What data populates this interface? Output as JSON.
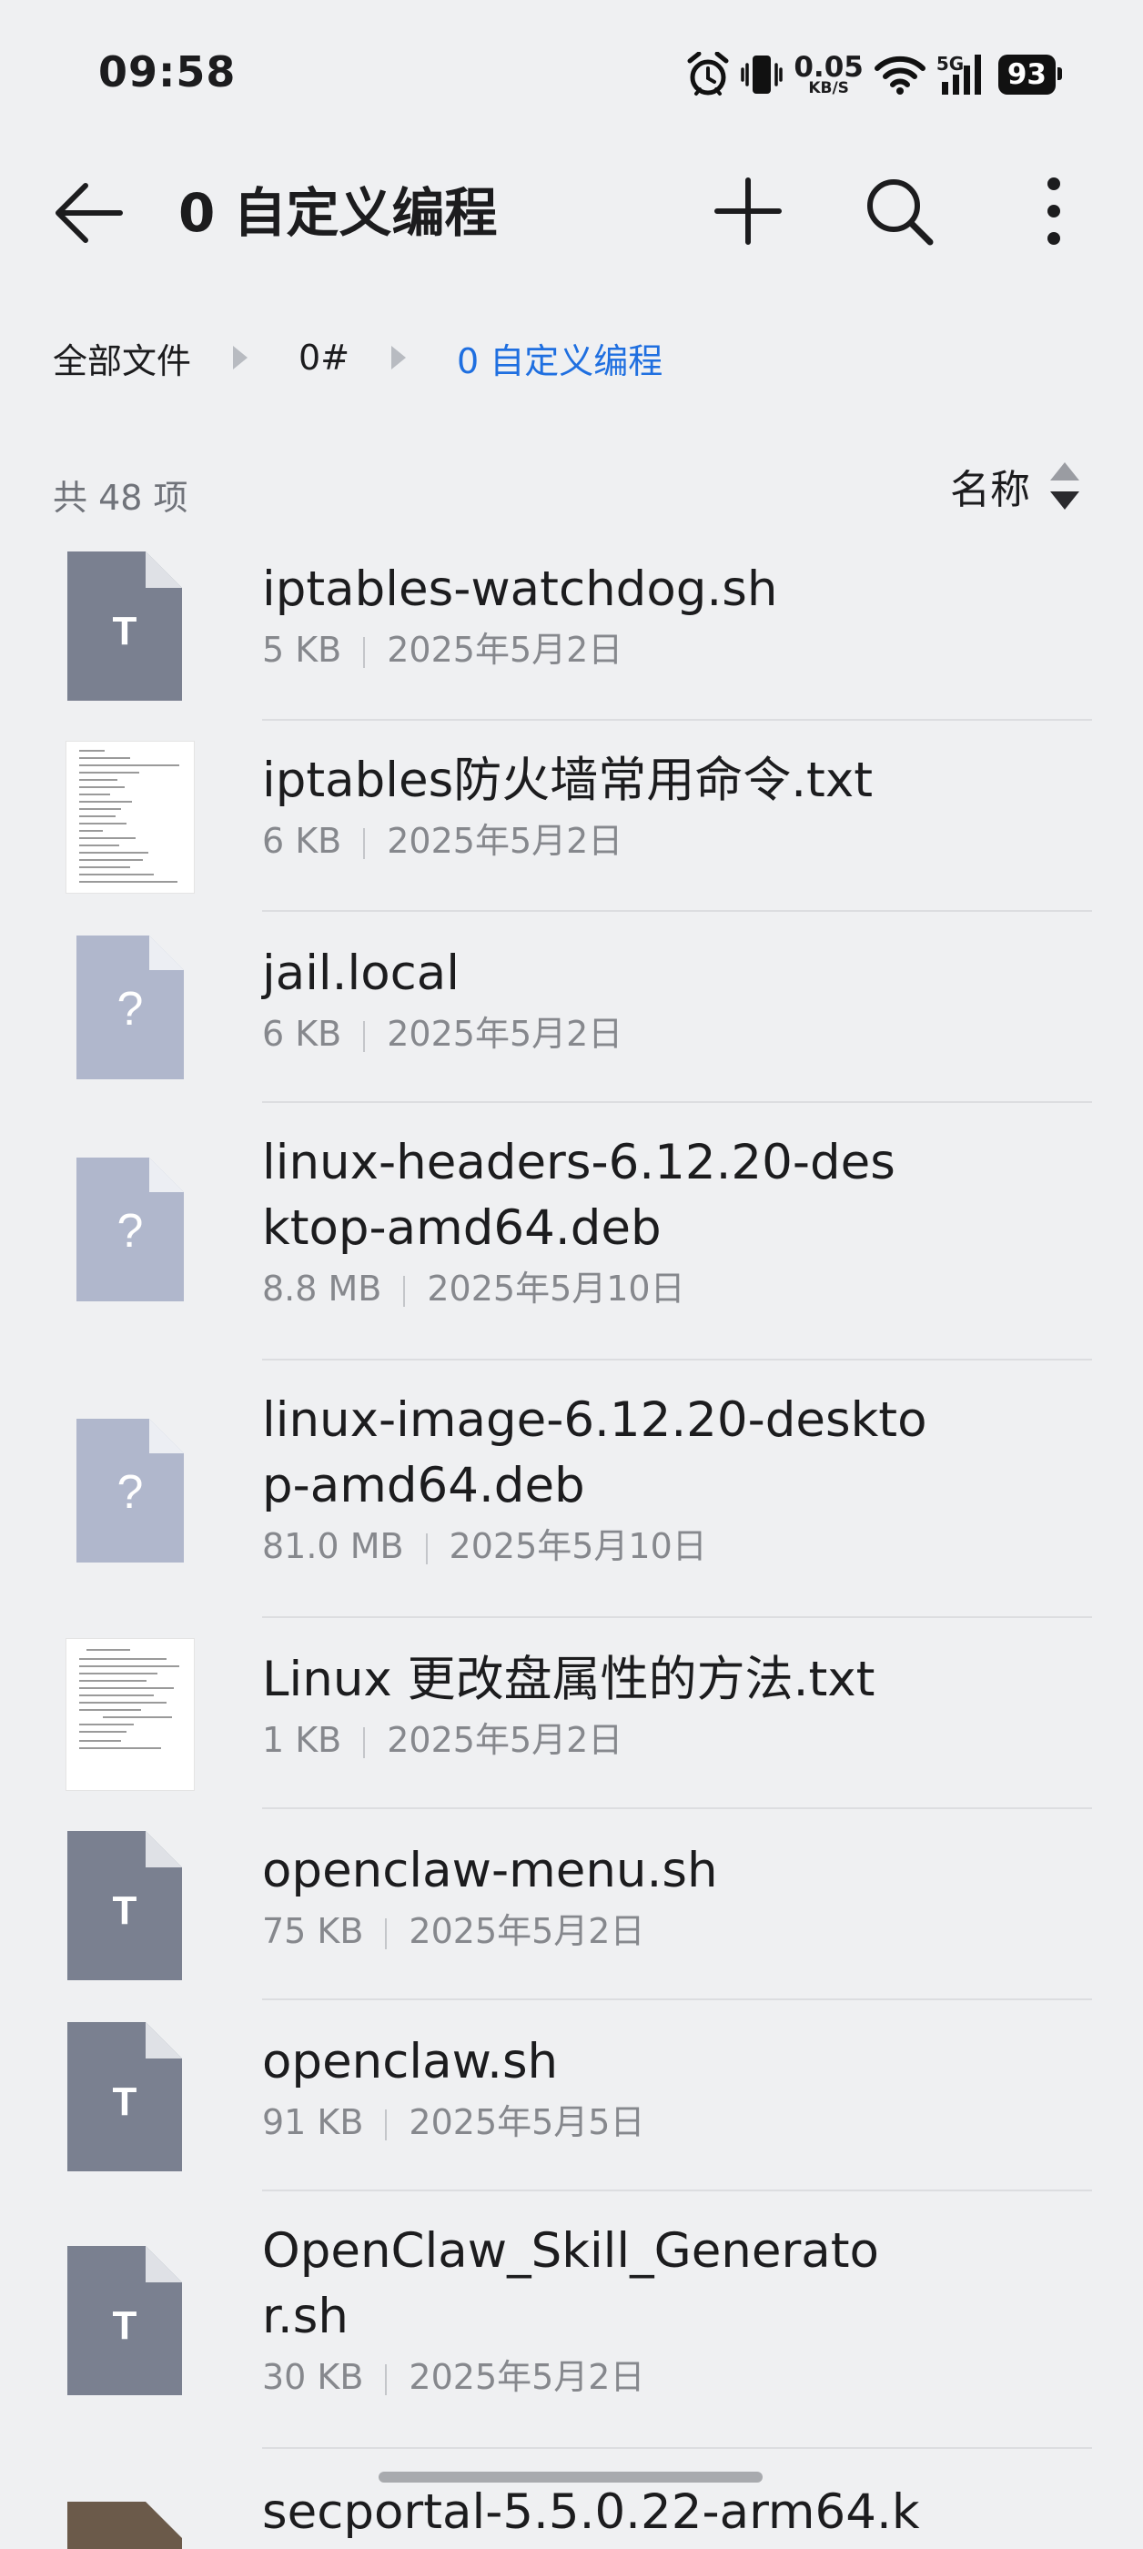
{
  "status_bar": {
    "time": "09:58",
    "net_speed_value": "0.05",
    "net_speed_unit": "KB/S",
    "network": "5G",
    "battery": "93",
    "icons": [
      "alarm-icon",
      "vibrate-icon",
      "wifi-icon",
      "signal-icon",
      "battery-icon"
    ]
  },
  "toolbar": {
    "title": "0 自定义编程",
    "icons": [
      "back-arrow-icon",
      "plus-icon",
      "search-icon",
      "more-vertical-icon"
    ]
  },
  "breadcrumb": {
    "items": [
      "全部文件",
      "0#",
      "0 自定义编程"
    ]
  },
  "list_header": {
    "count": "共 48 项",
    "sort_label": "名称"
  },
  "colors": {
    "background": "#eff0f2",
    "accent": "#1f6fe0",
    "text_icon": "#7a8090",
    "unknown_icon": "#b0b7cc"
  },
  "files": [
    {
      "name": "iptables-watchdog.sh",
      "size": "5 KB",
      "date": "2025年5月2日",
      "icon": "text-file-icon",
      "glyph": "T"
    },
    {
      "name": "iptables防火墙常用命令.txt",
      "size": "6 KB",
      "date": "2025年5月2日",
      "icon": "document-thumbnail"
    },
    {
      "name": "jail.local",
      "size": "6 KB",
      "date": "2025年5月2日",
      "icon": "unknown-file-icon",
      "glyph": "?"
    },
    {
      "name": "linux-headers-6.12.20-desktop-amd64.deb",
      "size": "8.8 MB",
      "date": "2025年5月10日",
      "icon": "unknown-file-icon",
      "glyph": "?"
    },
    {
      "name": "linux-image-6.12.20-desktop-amd64.deb",
      "size": "81.0 MB",
      "date": "2025年5月10日",
      "icon": "unknown-file-icon",
      "glyph": "?"
    },
    {
      "name": "Linux 更改盘属性的方法.txt",
      "size": "1 KB",
      "date": "2025年5月2日",
      "icon": "document-thumbnail"
    },
    {
      "name": "openclaw-menu.sh",
      "size": "75 KB",
      "date": "2025年5月2日",
      "icon": "text-file-icon",
      "glyph": "T"
    },
    {
      "name": "openclaw.sh",
      "size": "91 KB",
      "date": "2025年5月5日",
      "icon": "text-file-icon",
      "glyph": "T"
    },
    {
      "name": "OpenClaw_Skill_Generator.sh",
      "size": "30 KB",
      "date": "2025年5月2日",
      "icon": "text-file-icon",
      "glyph": "T"
    },
    {
      "name": "secportal-5.5.0.22-arm64.k",
      "size": "",
      "date": "",
      "icon": "package-file-icon"
    }
  ]
}
